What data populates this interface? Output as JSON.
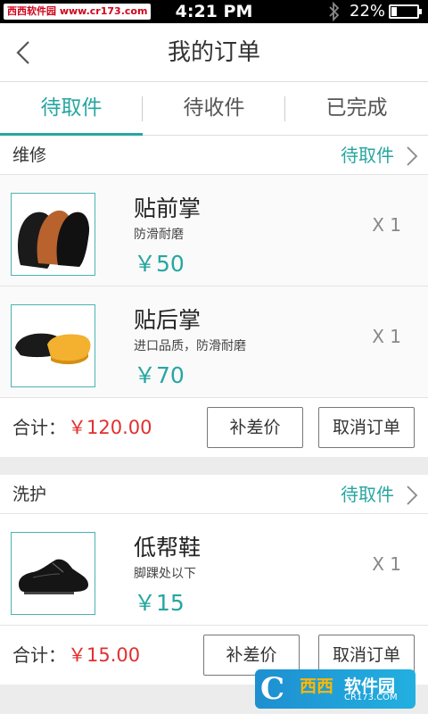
{
  "status_bar": {
    "watermark": "西西软件园 www.cr173.com",
    "time": "4:21 PM",
    "battery_pct": "22%",
    "battery_level": 0.22
  },
  "nav": {
    "title": "我的订单"
  },
  "tabs": [
    {
      "label": "待取件",
      "active": true
    },
    {
      "label": "待收件",
      "active": false
    },
    {
      "label": "已完成",
      "active": false
    }
  ],
  "orders": [
    {
      "type": "维修",
      "status": "待取件",
      "items": [
        {
          "name": "贴前掌",
          "desc": "防滑耐磨",
          "price": "￥50",
          "qty": "X 1",
          "icon": "sole-pads-icon"
        },
        {
          "name": "贴后掌",
          "desc": "进口品质，防滑耐磨",
          "price": "￥70",
          "qty": "X 1",
          "icon": "heel-pads-icon"
        }
      ],
      "total_label": "合计：",
      "total": "￥120.00",
      "diff_button": "补差价",
      "cancel_button": "取消订单"
    },
    {
      "type": "洗护",
      "status": "待取件",
      "items": [
        {
          "name": "低帮鞋",
          "desc": "脚踝处以下",
          "price": "￥15",
          "qty": "X 1",
          "icon": "leather-shoe-icon"
        }
      ],
      "total_label": "合计：",
      "total": "￥15.00",
      "diff_button": "补差价",
      "cancel_button": "取消订单"
    }
  ],
  "corner_logo": {
    "mark": "C",
    "text1": "西西",
    "text2": "软件园",
    "text3": "CR173.COM"
  },
  "colors": {
    "accent": "#27a6a1",
    "price_red": "#e03030"
  }
}
